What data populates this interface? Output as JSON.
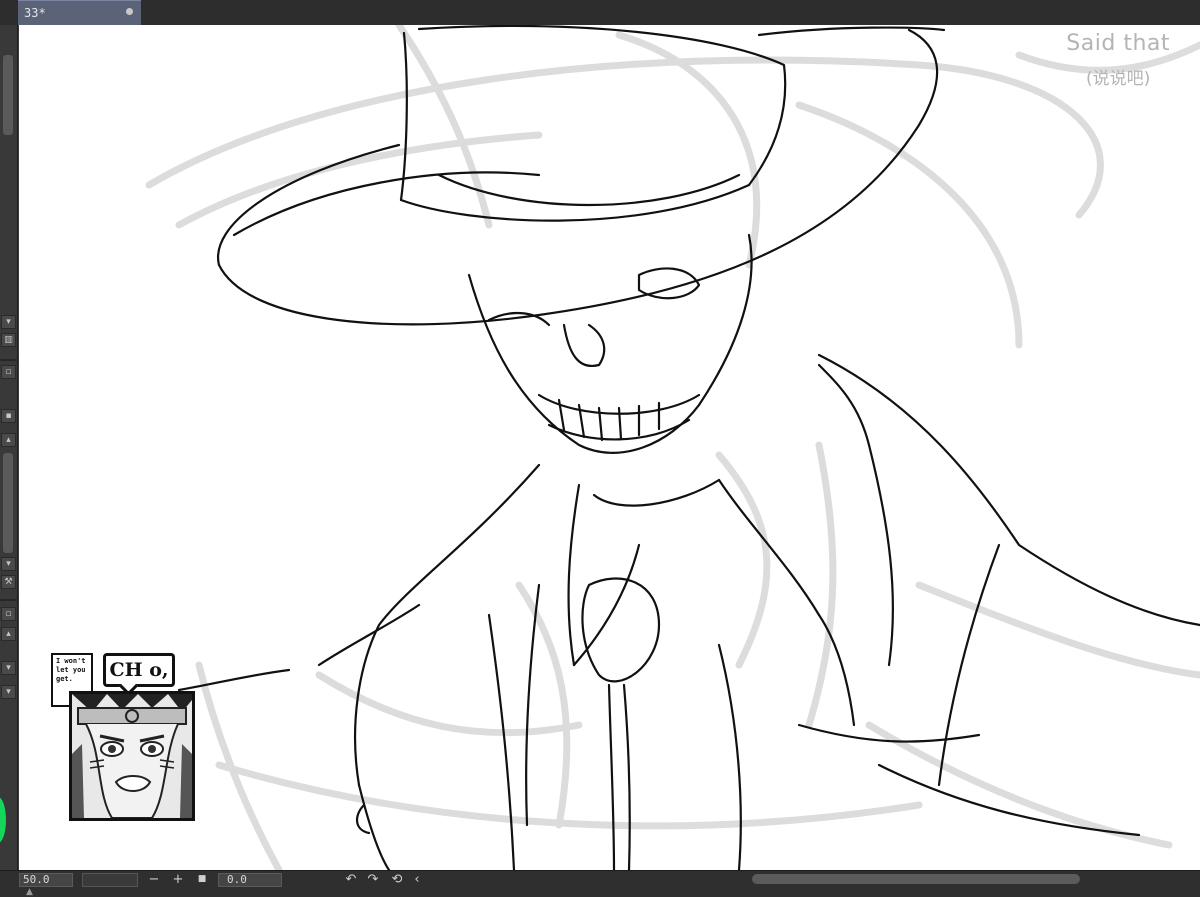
{
  "tab": {
    "title": "33*"
  },
  "caption": {
    "line1": "Said that",
    "line2": "(说说吧)"
  },
  "sticker": {
    "small_bubble": "I won't let you get.",
    "big_bubble": "CH o,"
  },
  "statusbar": {
    "zoom": "50.0",
    "zoom_out_label": "−",
    "zoom_in_label": "+",
    "fit_label": "■",
    "rotation": "0.0",
    "rotate_left_label": "↶",
    "rotate_right_label": "↷",
    "reset_rotation_label": "⟲",
    "flip_label": "‹"
  },
  "icons": [
    "chevron-down-icon",
    "chevron-up-icon",
    "trash-icon",
    "wrench-icon",
    "layer-icon"
  ],
  "colors": {
    "accent_tab": "#5b6379",
    "indicator": "#14d65a",
    "sketch_light": "#d6d6d6",
    "ink": "#111111"
  }
}
